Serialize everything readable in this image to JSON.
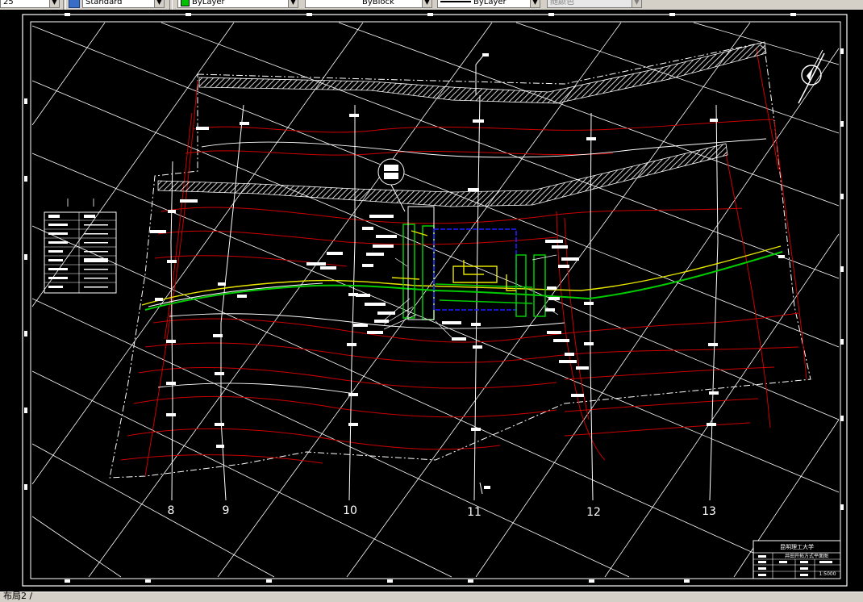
{
  "toolbar": {
    "scale_combo": "25",
    "style_combo": "Standard",
    "layer_combo": "ByLayer",
    "linetype_combo": "ByBlock",
    "lineweight_combo": "ByLayer",
    "plotstyle_combo": "随颜色"
  },
  "drawing": {
    "profile_labels": [
      "8",
      "9",
      "10",
      "11",
      "12",
      "13"
    ],
    "title_block": {
      "header": "昆明理工大学",
      "drawing_title": "井田开拓方式平面图",
      "scale_value": "1:5000"
    }
  },
  "colors": {
    "background": "#000000",
    "contour": "#cc0000",
    "grid": "#ffffff",
    "roadway_green": "#00cc00",
    "roadway_yellow": "#e6e600",
    "roadway_blue": "#2020ff"
  },
  "statusbar": {
    "layout_tab": "布局2 /"
  }
}
